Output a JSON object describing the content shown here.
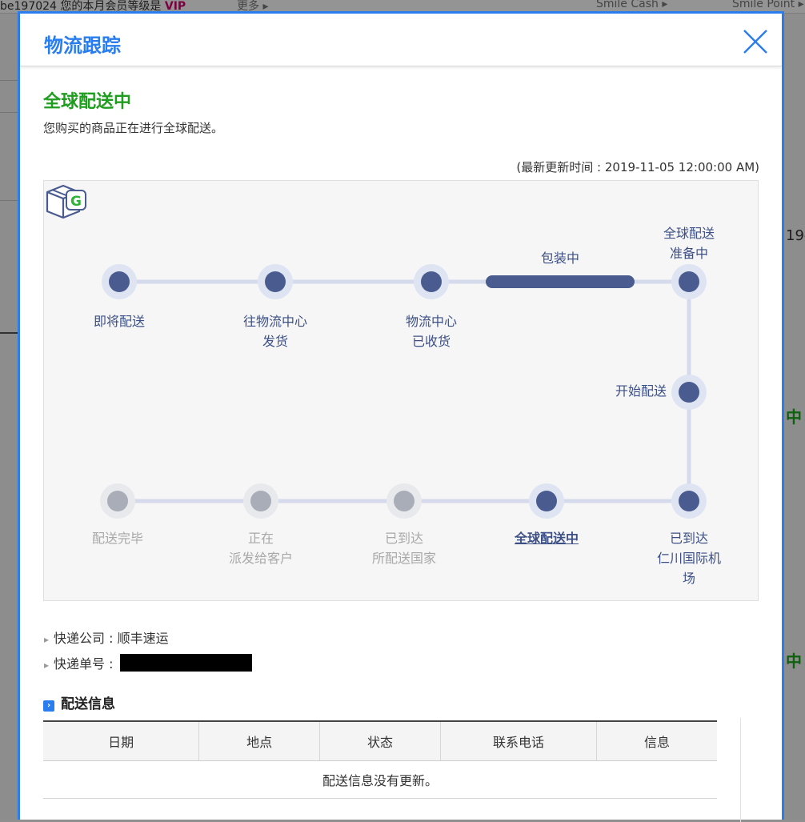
{
  "background": {
    "topbar_left": "be197024  您的本月会员等级是",
    "topbar_vip": "VIP",
    "topbar_more": "更多 ▸",
    "topbar_smile_cash": "Smile Cash ▸",
    "topbar_smile_point": "Smile Point ▸",
    "frag_right_1": "19-",
    "frag_right_2": "中",
    "frag_right_3": "中"
  },
  "modal": {
    "title": "物流跟踪",
    "status_title": "全球配送中",
    "status_desc": "您购买的商品正在进行全球配送。",
    "updated": "(最新更新时间 : 2019-11-05 12:00:00 AM)",
    "packing_label": "包装中",
    "steps": [
      {
        "label_1": "即将配送",
        "label_2": ""
      },
      {
        "label_1": "往物流中心",
        "label_2": "发货"
      },
      {
        "label_1": "物流中心",
        "label_2": "已收货"
      },
      {
        "label_1": "全球配送",
        "label_2": "准备中"
      },
      {
        "label_1": "开始配送",
        "label_2": ""
      },
      {
        "label_1": "已到达",
        "label_2": "仁川国际机",
        "label_3": "场"
      },
      {
        "label_1": "全球配送中",
        "label_2": ""
      },
      {
        "label_1": "已到达",
        "label_2": "所配送国家"
      },
      {
        "label_1": "正在",
        "label_2": "派发给客户"
      },
      {
        "label_1": "配送完毕",
        "label_2": ""
      }
    ],
    "courier_label": "快递公司 : 顺丰速运",
    "tracking_label": "快递单号 :",
    "section_title": "配送信息",
    "table": {
      "headers": [
        "日期",
        "地点",
        "状态",
        "联系电话",
        "信息"
      ],
      "empty_message": "配送信息没有更新。"
    }
  },
  "colors": {
    "accent": "#2a7dee",
    "status_green": "#1f9d1f",
    "node_active": "#4a5c8f",
    "node_inactive": "#a9adb8",
    "track_line": "#d5dbec"
  }
}
